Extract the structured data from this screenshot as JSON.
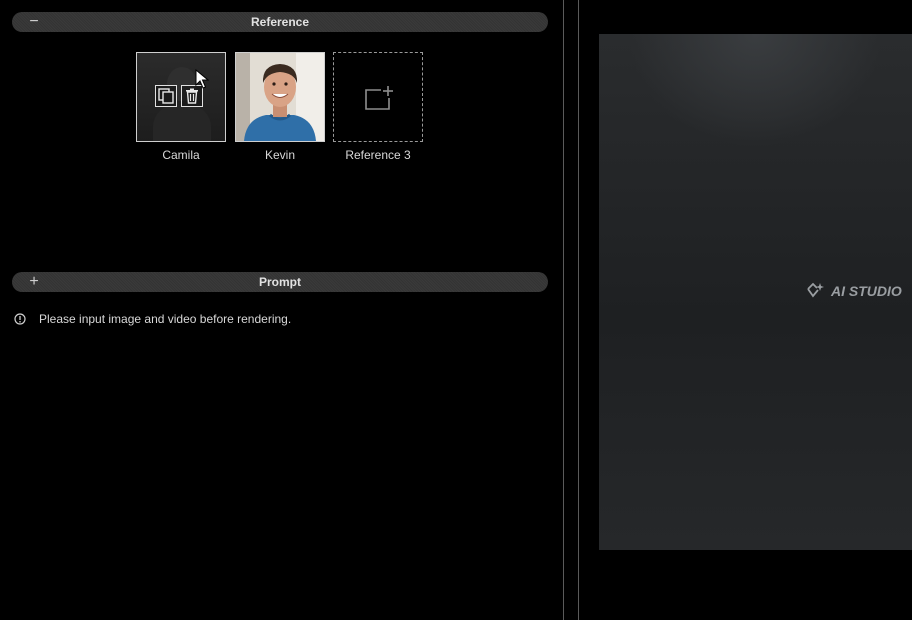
{
  "reference": {
    "title": "Reference",
    "toggle": "−",
    "cards": [
      {
        "name": "Camila",
        "state": "hover",
        "icon": "person-photo"
      },
      {
        "name": "Kevin",
        "icon": "person-photo"
      },
      {
        "name": "Reference 3",
        "icon": "add-image-icon"
      }
    ],
    "hover_actions": [
      "duplicate-icon",
      "trash-icon"
    ]
  },
  "prompt": {
    "title": "Prompt",
    "toggle": "+"
  },
  "notice": {
    "icon": "info-icon",
    "text": "Please input image and video before rendering."
  },
  "preview": {
    "watermark": "AI STUDIO"
  }
}
